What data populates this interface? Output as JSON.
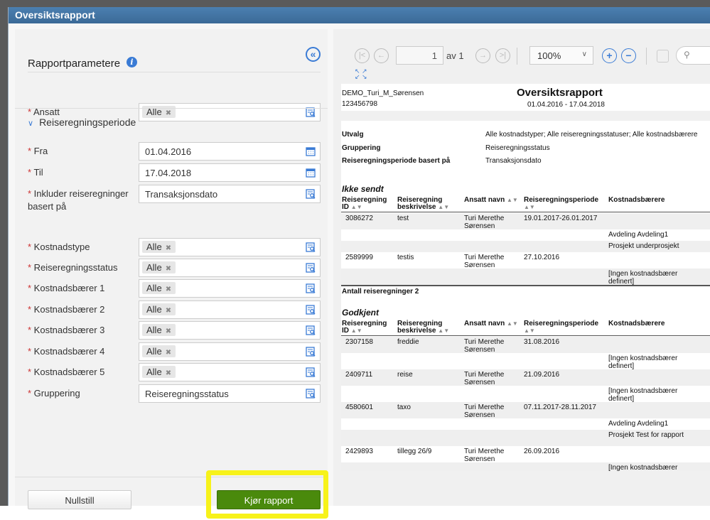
{
  "window": {
    "title": "Oversiktsrapport"
  },
  "params": {
    "title": "Rapportparametere",
    "section": "Reiseregningsperiode",
    "fields": [
      {
        "label": "Ansatt",
        "chip": "Alle"
      },
      {
        "label": "Fra",
        "value": "01.04.2016"
      },
      {
        "label": "Til",
        "value": "17.04.2018"
      },
      {
        "label": "Inkluder reiseregninger basert på",
        "value": "Transaksjonsdato"
      },
      {
        "label": "Kostnadstype",
        "chip": "Alle"
      },
      {
        "label": "Reiseregningsstatus",
        "chip": "Alle"
      },
      {
        "label": "Kostnadsbærer 1",
        "chip": "Alle"
      },
      {
        "label": "Kostnadsbærer 2",
        "chip": "Alle"
      },
      {
        "label": "Kostnadsbærer 3",
        "chip": "Alle"
      },
      {
        "label": "Kostnadsbærer 4",
        "chip": "Alle"
      },
      {
        "label": "Kostnadsbærer 5",
        "chip": "Alle"
      },
      {
        "label": "Gruppering",
        "value": "Reiseregningsstatus"
      }
    ],
    "reset_label": "Nullstill",
    "run_label": "Kjør rapport"
  },
  "viewer": {
    "page": "1",
    "of_label": "av 1",
    "zoom": "100%"
  },
  "report": {
    "user": "DEMO_Turi_M_Sørensen",
    "number": "123456798",
    "title": "Oversiktsrapport",
    "period": "01.04.2016 - 17.04.2018",
    "meta": [
      {
        "k": "Utvalg",
        "v": "Alle kostnadstyper; Alle reiseregningsstatuser; Alle kostnadsbærere"
      },
      {
        "k": "Gruppering",
        "v": "Reiseregningsstatus"
      },
      {
        "k": "Reiseregningsperiode basert på",
        "v": "Transaksjonsdato"
      }
    ],
    "columns": [
      "Reiseregning ID",
      "Reiseregning beskrivelse",
      "Ansatt navn",
      "Reiseregningsperiode",
      "Kostnadsbærere"
    ],
    "groups": [
      {
        "name": "Ikke sendt",
        "footer": "Antall reiseregninger 2",
        "records": [
          {
            "id": "3086272",
            "desc": "test",
            "emp": "Turi Merethe Sørensen",
            "period": "19.01.2017-26.01.2017",
            "carriers": [
              "Avdeling Avdeling1",
              "Prosjekt underprosjekt"
            ]
          },
          {
            "id": "2589999",
            "desc": "testis",
            "emp": "Turi Merethe Sørensen",
            "period": "27.10.2016",
            "carriers": [
              "[Ingen kostnadsbærer definert]"
            ]
          }
        ]
      },
      {
        "name": "Godkjent",
        "records": [
          {
            "id": "2307158",
            "desc": "freddie",
            "emp": "Turi Merethe Sørensen",
            "period": "31.08.2016",
            "carriers": [
              "[Ingen kostnadsbærer definert]"
            ]
          },
          {
            "id": "2409711",
            "desc": "reise",
            "emp": "Turi Merethe Sørensen",
            "period": "21.09.2016",
            "carriers": [
              "[Ingen kostnadsbærer definert]"
            ]
          },
          {
            "id": "4580601",
            "desc": "taxo",
            "emp": "Turi Merethe Sørensen",
            "period": "07.11.2017-28.11.2017",
            "carriers": [
              "Avdeling Avdeling1",
              "Prosjekt Test for rapport"
            ]
          },
          {
            "id": "2429893",
            "desc": "tillegg 26/9",
            "emp": "Turi Merethe Sørensen",
            "period": "26.09.2016",
            "carriers": [
              "[Ingen kostnadsbærer definert]"
            ]
          }
        ]
      }
    ]
  }
}
